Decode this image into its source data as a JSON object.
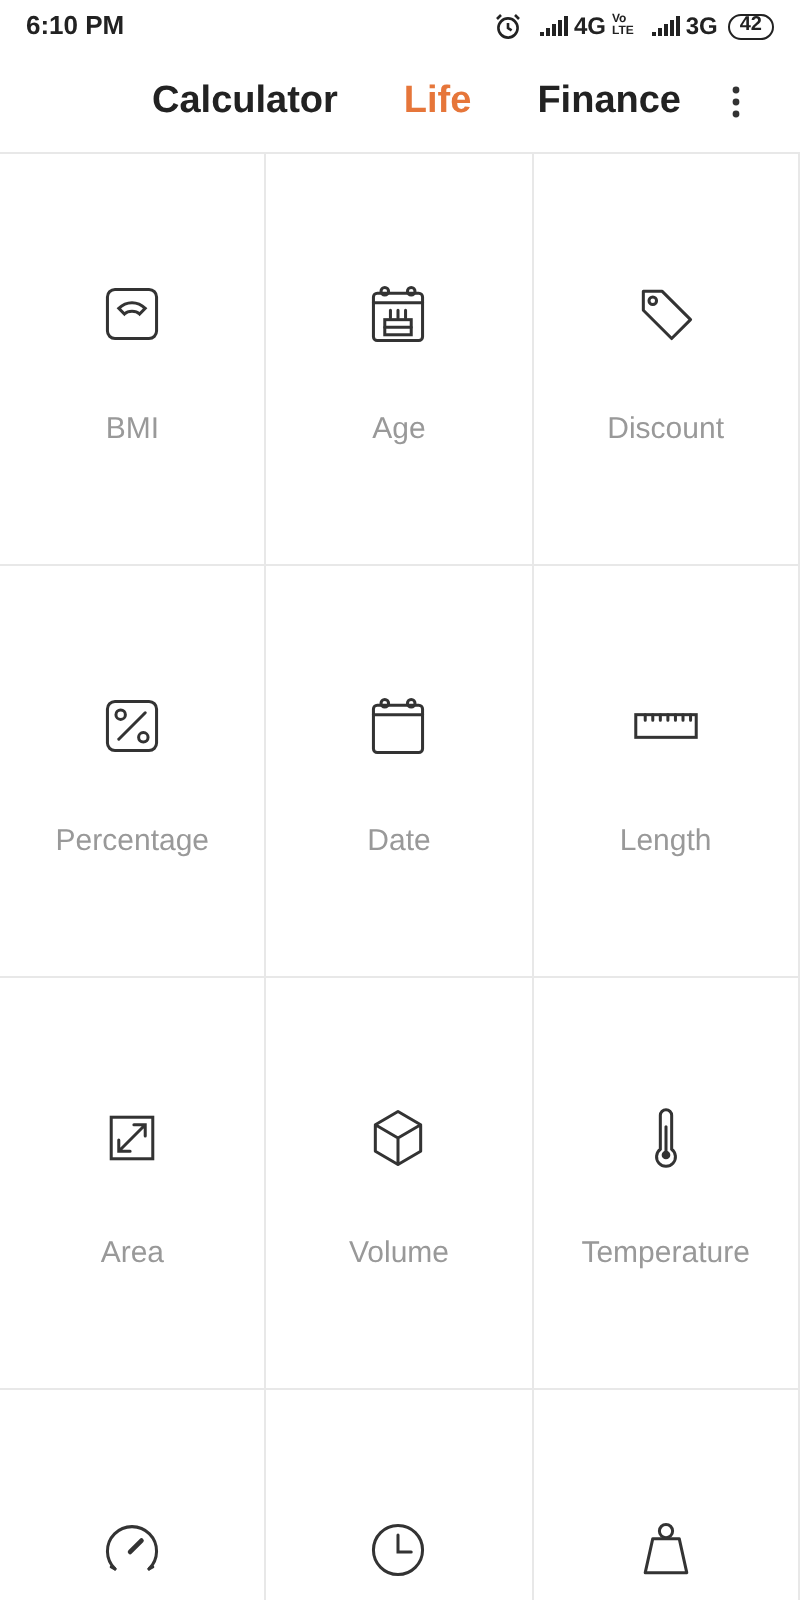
{
  "status_bar": {
    "time": "6:10 PM",
    "network_1": "4G",
    "volte": [
      "Vo",
      "LTE"
    ],
    "network_2": "3G",
    "battery": "42"
  },
  "tabs": [
    {
      "label": "Calculator",
      "selected": false
    },
    {
      "label": "Life",
      "selected": true
    },
    {
      "label": "Finance",
      "selected": false
    }
  ],
  "tools": [
    {
      "kind": "scale",
      "label": "BMI"
    },
    {
      "kind": "cake-calendar",
      "label": "Age"
    },
    {
      "kind": "tag",
      "label": "Discount"
    },
    {
      "kind": "percent",
      "label": "Percentage"
    },
    {
      "kind": "calendar",
      "label": "Date"
    },
    {
      "kind": "ruler",
      "label": "Length"
    },
    {
      "kind": "area",
      "label": "Area"
    },
    {
      "kind": "cube",
      "label": "Volume"
    },
    {
      "kind": "thermometer",
      "label": "Temperature"
    },
    {
      "kind": "gauge"
    },
    {
      "kind": "clock"
    },
    {
      "kind": "weight"
    }
  ]
}
